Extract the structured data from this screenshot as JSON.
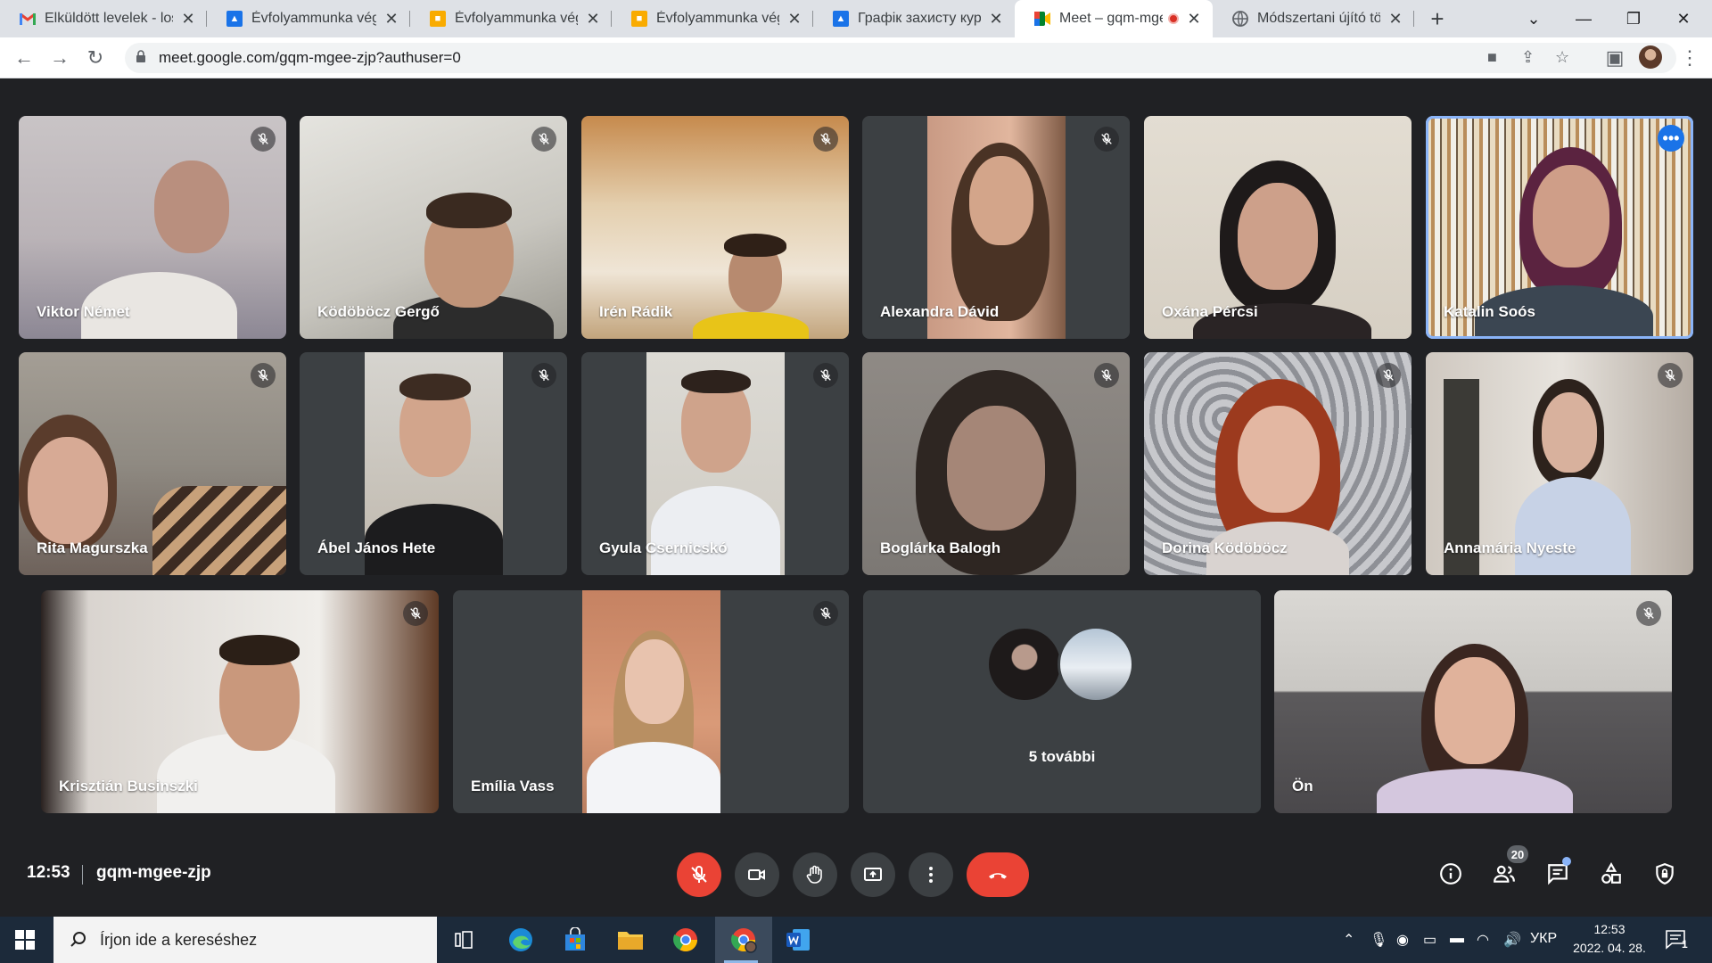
{
  "browser": {
    "tabs": [
      {
        "title": "Elküldött levelek - los",
        "icon": "gmail-icon",
        "color": "#ea4335"
      },
      {
        "title": "Évfolyammunka végle",
        "icon": "google-docs-person-icon",
        "color": "#1a73e8"
      },
      {
        "title": "Évfolyammunka végle",
        "icon": "google-classroom-icon",
        "color": "#1e8e3e"
      },
      {
        "title": "Évfolyammunka végle",
        "icon": "google-classroom-icon",
        "color": "#1e8e3e"
      },
      {
        "title": "Графік захисту курсо",
        "icon": "google-docs-person-icon",
        "color": "#1a73e8"
      },
      {
        "title": "Meet – gqm-mge",
        "icon": "google-meet-icon",
        "color": "#00832d",
        "active": true,
        "recording": true
      },
      {
        "title": "Módszertani újító tör",
        "icon": "globe-icon",
        "color": "#5f6368"
      }
    ],
    "url": "meet.google.com/gqm-mgee-zjp?authuser=0"
  },
  "meet": {
    "participants": [
      {
        "name": "Viktor Német",
        "muted": true
      },
      {
        "name": "Ködöböcz Gergő",
        "muted": true
      },
      {
        "name": "Irén Rádik",
        "muted": true
      },
      {
        "name": "Alexandra Dávid",
        "muted": true
      },
      {
        "name": "Oxána Pércsi",
        "muted": false
      },
      {
        "name": "Katalin Soós",
        "muted": false,
        "speaking": true
      },
      {
        "name": "Rita Magurszka",
        "muted": true
      },
      {
        "name": "Ábel János Hete",
        "muted": true
      },
      {
        "name": "Gyula Csernicskó",
        "muted": true
      },
      {
        "name": "Boglárka Balogh",
        "muted": true
      },
      {
        "name": "Dorina Ködöböcz",
        "muted": true
      },
      {
        "name": "Annamária Nyeste",
        "muted": true
      },
      {
        "name": "Krisztián Businszki",
        "muted": true
      },
      {
        "name": "Emília Vass",
        "muted": true
      },
      {
        "name": "Ön",
        "muted": true
      }
    ],
    "more_participants_label": "5 további",
    "time": "12:53",
    "meeting_code": "gqm-mgee-zjp",
    "participant_count": "20",
    "accent_color": "#8ab4f8",
    "end_call_color": "#ea4335"
  },
  "taskbar": {
    "search_placeholder": "Írjon ide a kereséshez",
    "language": "УКР",
    "time": "12:53",
    "date": "2022. 04. 28.",
    "notification_count": "1"
  }
}
